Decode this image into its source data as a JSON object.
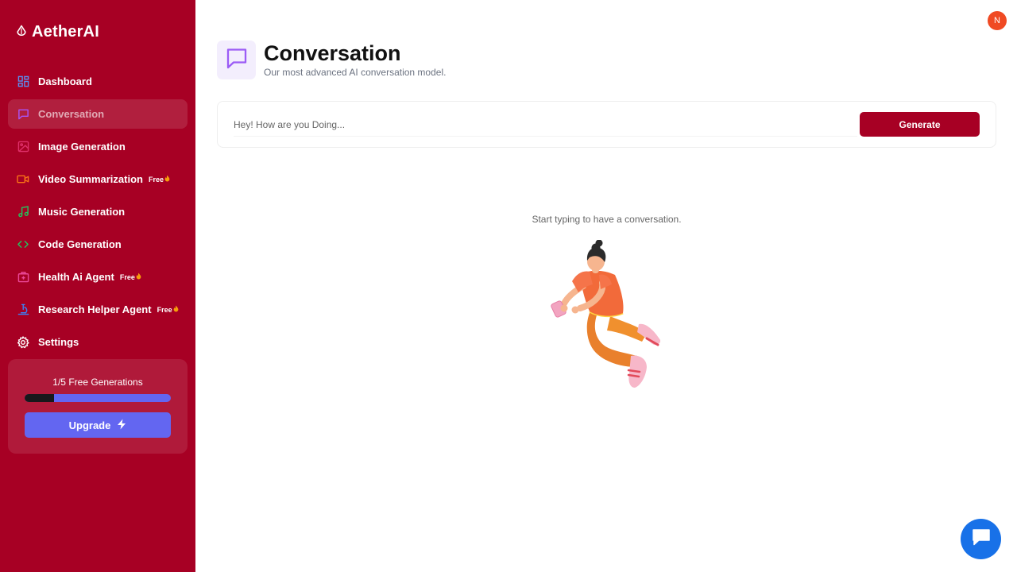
{
  "app": {
    "name": "AetherAI"
  },
  "sidebar": {
    "items": [
      {
        "label": "Dashboard",
        "icon": "dashboard-icon",
        "active": false,
        "badge": "",
        "icon_color": "#5b8def"
      },
      {
        "label": "Conversation",
        "icon": "message-square-icon",
        "active": true,
        "badge": "",
        "icon_color": "#9b5cf6"
      },
      {
        "label": "Image Generation",
        "icon": "image-icon",
        "active": false,
        "badge": "",
        "icon_color": "#e0306a"
      },
      {
        "label": "Video Summarization",
        "icon": "video-icon",
        "active": false,
        "badge": "Free",
        "icon_color": "#f97316"
      },
      {
        "label": "Music Generation",
        "icon": "music-icon",
        "active": false,
        "badge": "",
        "icon_color": "#22c55e"
      },
      {
        "label": "Code Generation",
        "icon": "code-icon",
        "active": false,
        "badge": "",
        "icon_color": "#22c55e"
      },
      {
        "label": "Health Ai Agent",
        "icon": "medical-bag-icon",
        "active": false,
        "badge": "Free",
        "icon_color": "#ec4899"
      },
      {
        "label": "Research Helper Agent",
        "icon": "microscope-icon",
        "active": false,
        "badge": "Free",
        "icon_color": "#3b82f6"
      },
      {
        "label": "Settings",
        "icon": "settings-icon",
        "active": false,
        "badge": "",
        "icon_color": "#ffffff"
      }
    ],
    "generations": {
      "count_text": "1/5 Free Generations",
      "used": 1,
      "limit": 5,
      "upgrade_label": "Upgrade"
    }
  },
  "user": {
    "avatar_initial": "N"
  },
  "page": {
    "title": "Conversation",
    "subtitle": "Our most advanced AI conversation model.",
    "prompt_placeholder": "Hey! How are you Doing...",
    "generate_label": "Generate",
    "empty_state_text": "Start typing to have a conversation."
  },
  "colors": {
    "brand": "#a70024",
    "accent": "#6366f1",
    "chat_button": "#1871e8",
    "avatar": "#f04a23"
  }
}
